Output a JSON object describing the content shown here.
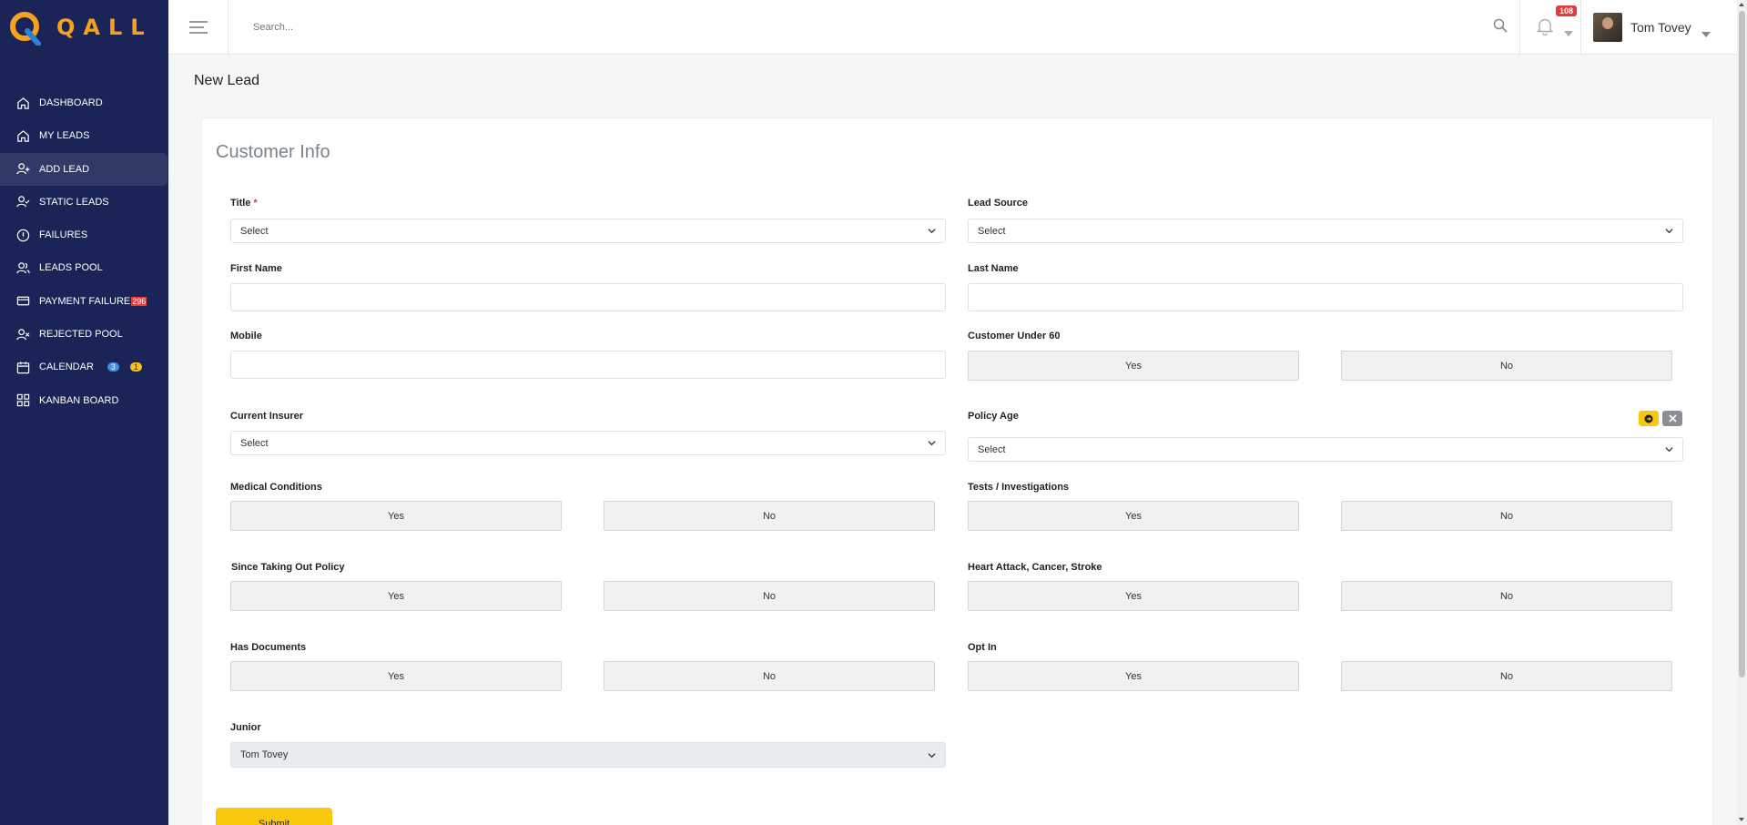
{
  "app": {
    "logo_text": "QALL",
    "brand_color": "#f5a21e",
    "sidebar_color": "#1b2457"
  },
  "sidebar": {
    "items": [
      {
        "label": "DASHBOARD",
        "icon": "home-icon"
      },
      {
        "label": "MY LEADS",
        "icon": "home-icon"
      },
      {
        "label": "ADD LEAD",
        "icon": "user-plus-icon",
        "active": true
      },
      {
        "label": "STATIC LEADS",
        "icon": "user-check-icon"
      },
      {
        "label": "FAILURES",
        "icon": "alert-circle-icon"
      },
      {
        "label": "LEADS POOL",
        "icon": "users-icon"
      },
      {
        "label": "PAYMENT FAILURE",
        "icon": "credit-card-icon",
        "badge": "296"
      },
      {
        "label": "REJECTED POOL",
        "icon": "user-x-icon"
      },
      {
        "label": "CALENDAR",
        "icon": "calendar-icon",
        "badge_blue": "3",
        "badge_yellow": "1"
      },
      {
        "label": "KANBAN BOARD",
        "icon": "grid-icon"
      }
    ]
  },
  "header": {
    "search_placeholder": "Search...",
    "notifications_count": "108",
    "user_name": "Tom Tovey"
  },
  "page": {
    "title": "New Lead",
    "card_title": "Customer Info"
  },
  "form": {
    "title_label": "Title",
    "title_required": "*",
    "title_value": "Select",
    "lead_source_label": "Lead Source",
    "lead_source_value": "Select",
    "first_name_label": "First Name",
    "last_name_label": "Last Name",
    "mobile_label": "Mobile",
    "customer_under_60_label": "Customer Under 60",
    "current_insurer_label": "Current Insurer",
    "current_insurer_value": "Select",
    "policy_age_label": "Policy Age",
    "policy_age_value": "Select",
    "medical_conditions_label": "Medical Conditions",
    "tests_label": "Tests / Investigations",
    "since_policy_label": "Since Taking Out Policy",
    "heart_attack_label": "Heart Attack, Cancer, Stroke",
    "has_documents_label": "Has Documents",
    "opt_in_label": "Opt In",
    "junior_label": "Junior",
    "junior_value": "Tom Tovey",
    "yes": "Yes",
    "no": "No",
    "submit_label": "Submit"
  }
}
